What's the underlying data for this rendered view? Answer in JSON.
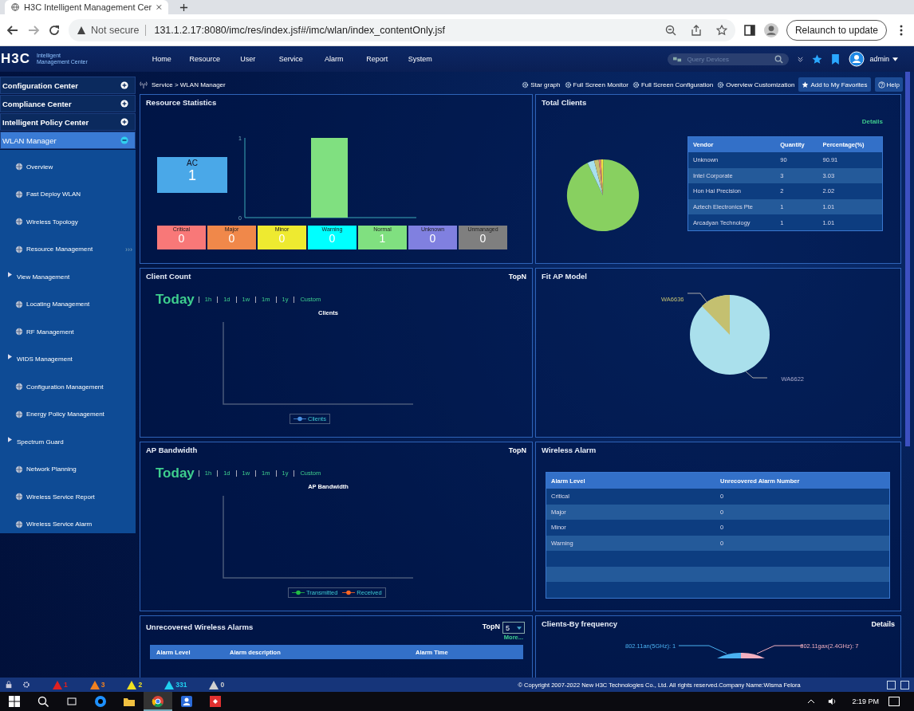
{
  "browser": {
    "tab_title": "H3C Intelligent Management Cer",
    "security": "Not secure",
    "url": "131.1.2.17:8080/imc/res/index.jsf#/imc/wlan/index_contentOnly.jsf",
    "relaunch": "Relaunch to update"
  },
  "header": {
    "logo": "H3C",
    "product": [
      "Intelligent",
      "Management Center"
    ],
    "nav": [
      "Home",
      "Resource",
      "User",
      "Service",
      "Alarm",
      "Report",
      "System"
    ],
    "search_placeholder": "Query Devices",
    "user": "admin"
  },
  "sidebar": {
    "groups": [
      {
        "label": "Configuration Center",
        "expanded": false,
        "selected": false
      },
      {
        "label": "Compliance Center",
        "expanded": false,
        "selected": false
      },
      {
        "label": "Intelligent Policy Center",
        "expanded": false,
        "selected": false
      },
      {
        "label": "WLAN Manager",
        "expanded": true,
        "selected": true
      }
    ],
    "items": [
      {
        "label": "Overview",
        "kind": "link"
      },
      {
        "label": "Fast Deploy WLAN",
        "kind": "link"
      },
      {
        "label": "Wireless Topology",
        "kind": "link"
      },
      {
        "label": "Resource Management",
        "kind": "link"
      },
      {
        "label": "View Management",
        "kind": "folder"
      },
      {
        "label": "Locating Management",
        "kind": "link"
      },
      {
        "label": "RF Management",
        "kind": "link"
      },
      {
        "label": "WIDS Management",
        "kind": "folder"
      },
      {
        "label": "Configuration Management",
        "kind": "link"
      },
      {
        "label": "Energy Policy Management",
        "kind": "link"
      },
      {
        "label": "Spectrum Guard",
        "kind": "folder"
      },
      {
        "label": "Network Planning",
        "kind": "link"
      },
      {
        "label": "Wireless Service Report",
        "kind": "link"
      },
      {
        "label": "Wireless Service Alarm",
        "kind": "link"
      }
    ],
    "collapse_handle": "›››"
  },
  "breadcrumb": "Service > WLAN Manager",
  "toolbar": [
    {
      "label": "Star graph",
      "kind": "link"
    },
    {
      "label": "Full Screen Monitor",
      "kind": "link"
    },
    {
      "label": "Full Screen Configuration",
      "kind": "link"
    },
    {
      "label": "Overview Customization",
      "kind": "link"
    },
    {
      "label": "Add to My Favorites",
      "kind": "button"
    },
    {
      "label": "Help",
      "kind": "button"
    }
  ],
  "resource_statistics": {
    "title": "Resource Statistics",
    "ac": {
      "label": "AC",
      "value": "1"
    },
    "chart_data": {
      "type": "bar",
      "values": [
        1
      ],
      "ylim": [
        0,
        1
      ],
      "yticks": [
        0,
        1
      ]
    },
    "levels": [
      {
        "label": "Critical",
        "value": "0",
        "color": "#f87878"
      },
      {
        "label": "Major",
        "value": "0",
        "color": "#f0884a"
      },
      {
        "label": "Minor",
        "value": "0",
        "color": "#eeea30"
      },
      {
        "label": "Warning",
        "value": "0",
        "color": "#00ffff"
      },
      {
        "label": "Normal",
        "value": "1",
        "color": "#80e080"
      },
      {
        "label": "Unknown",
        "value": "0",
        "color": "#8080e0"
      },
      {
        "label": "Unmanaged",
        "value": "0",
        "color": "#7f7f7f"
      }
    ]
  },
  "total_clients": {
    "title": "Total Clients",
    "details": "Details",
    "columns": [
      "Vendor",
      "Quantity",
      "Percentage(%)"
    ],
    "rows": [
      [
        "Unknown",
        "90",
        "90.91"
      ],
      [
        "Intel Corporate",
        "3",
        "3.03"
      ],
      [
        "Hon Hai Precision",
        "2",
        "2.02"
      ],
      [
        "Aztech Electronics Pte",
        "1",
        "1.01"
      ],
      [
        "Arcadyan Technology",
        "1",
        "1.01"
      ]
    ]
  },
  "client_count": {
    "title": "Client Count",
    "topn": "TopN",
    "today": "Today",
    "ranges": [
      "1h",
      "1d",
      "1w",
      "1m",
      "1y",
      "Custom"
    ],
    "chart_title": "Clients",
    "legend": [
      {
        "label": "Clients",
        "color": "#4a90e2"
      }
    ]
  },
  "fit_ap_model": {
    "title": "Fit AP Model",
    "labels": [
      "WA6636",
      "WA6622"
    ]
  },
  "ap_bandwidth": {
    "title": "AP Bandwidth",
    "topn": "TopN",
    "today": "Today",
    "ranges": [
      "1h",
      "1d",
      "1w",
      "1m",
      "1y",
      "Custom"
    ],
    "chart_title": "AP Bandwidth",
    "legend": [
      {
        "label": "Transmitted",
        "color": "#22bb44"
      },
      {
        "label": "Received",
        "color": "#ff6622"
      }
    ]
  },
  "wireless_alarm": {
    "title": "Wireless Alarm",
    "columns": [
      "Alarm Level",
      "Unrecovered Alarm Number"
    ],
    "rows": [
      [
        "Critical",
        "0"
      ],
      [
        "Major",
        "0"
      ],
      [
        "Minor",
        "0"
      ],
      [
        "Warning",
        "0"
      ]
    ]
  },
  "unrecovered_alarms": {
    "title": "Unrecovered Wireless Alarms",
    "topn": "TopN",
    "topn_value": "5",
    "more": "More...",
    "columns": [
      "Alarm Level",
      "Alarm description",
      "Alarm Time"
    ]
  },
  "clients_by_frequency": {
    "title": "Clients-By frequency",
    "details": "Details",
    "labels": [
      "802.11an(5GHz): 1",
      "802.11gax(2.4GHz): 7"
    ]
  },
  "status_bar": {
    "alarms": [
      {
        "count": "1",
        "color": "#e02020"
      },
      {
        "count": "3",
        "color": "#f08020"
      },
      {
        "count": "2",
        "color": "#f0e020"
      },
      {
        "count": "331",
        "color": "#20d0f0"
      },
      {
        "count": "0",
        "color": "#d0d0d0"
      }
    ],
    "copyright": "© Copyright 2007-2022 New H3C Technologies Co., Ltd. All rights reserved.Company Name:Wisma Felora"
  },
  "taskbar": {
    "time": "2:19 PM"
  }
}
